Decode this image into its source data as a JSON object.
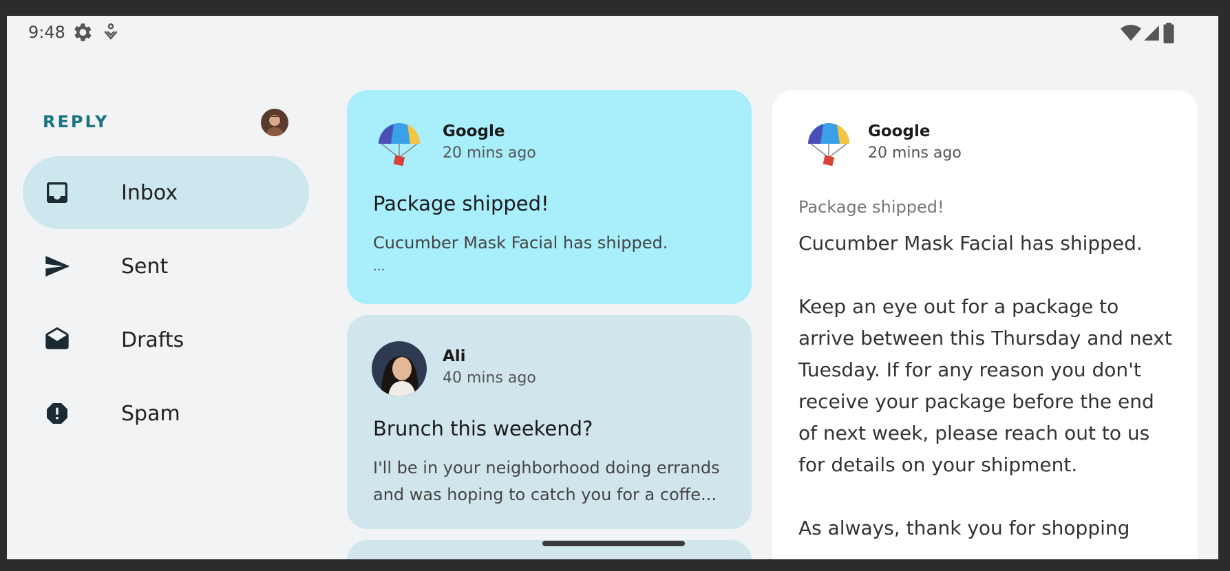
{
  "status_bar": {
    "time": "9:48"
  },
  "app": {
    "brand": "REPLY"
  },
  "nav": {
    "items": [
      {
        "label": "Inbox",
        "icon": "inbox-icon",
        "active": true
      },
      {
        "label": "Sent",
        "icon": "send-icon",
        "active": false
      },
      {
        "label": "Drafts",
        "icon": "drafts-icon",
        "active": false
      },
      {
        "label": "Spam",
        "icon": "spam-icon",
        "active": false
      }
    ]
  },
  "emails": [
    {
      "sender": "Google",
      "time": "20 mins ago",
      "subject": "Package shipped!",
      "preview": "Cucumber Mask Facial has shipped.",
      "preview_line2": "...",
      "avatar": "parachute-logo"
    },
    {
      "sender": "Ali",
      "time": "40 mins ago",
      "subject": "Brunch this weekend?",
      "preview": "I'll be in your neighborhood doing errands and was hoping to catch you for a coffe...",
      "avatar": "ali-avatar"
    }
  ],
  "detail": {
    "sender": "Google",
    "time": "20 mins ago",
    "subject": "Package shipped!",
    "body": "Cucumber Mask Facial has shipped.\n\nKeep an eye out for a package to arrive between this Thursday and next Tuesday. If for any reason you don't receive your package before the end of next week, please reach out to us for details on your shipment.\n\nAs always, thank you for shopping"
  },
  "colors": {
    "selected_card": "#a9eefb",
    "card": "#d1e6ec",
    "active_nav": "#cde7ee",
    "brand": "#1a7380"
  }
}
